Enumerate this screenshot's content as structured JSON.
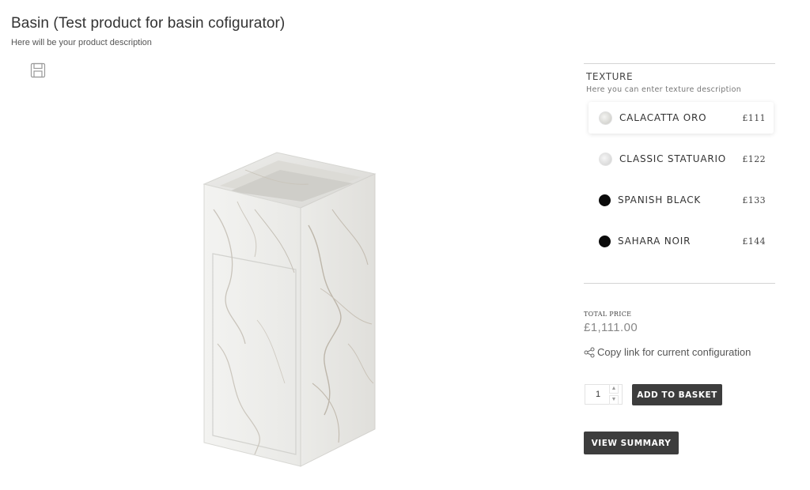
{
  "product": {
    "title": "Basin (Test product for basin cofigurator)",
    "description": "Here will be your product description",
    "save_icon": "floppy-disk-icon"
  },
  "texture": {
    "heading": "TEXTURE",
    "description": "Here you can enter texture description",
    "options": [
      {
        "name": "CALACATTA ORO",
        "price": "£111",
        "swatch": "marble",
        "selected": true
      },
      {
        "name": "CLASSIC STATUARIO",
        "price": "£122",
        "swatch": "marble",
        "selected": false
      },
      {
        "name": "SPANISH BLACK",
        "price": "£133",
        "swatch": "#0b0b0b",
        "selected": false
      },
      {
        "name": "SAHARA NOIR",
        "price": "£144",
        "swatch": "#0b0b0b",
        "selected": false
      }
    ]
  },
  "pricing": {
    "label": "TOTAL PRICE",
    "value": "£1,111.00"
  },
  "share": {
    "label": "Copy link for current configuration",
    "icon": "share-icon"
  },
  "cart": {
    "quantity": "1",
    "add_label": "ADD TO BASKET",
    "summary_label": "VIEW SUMMARY"
  }
}
